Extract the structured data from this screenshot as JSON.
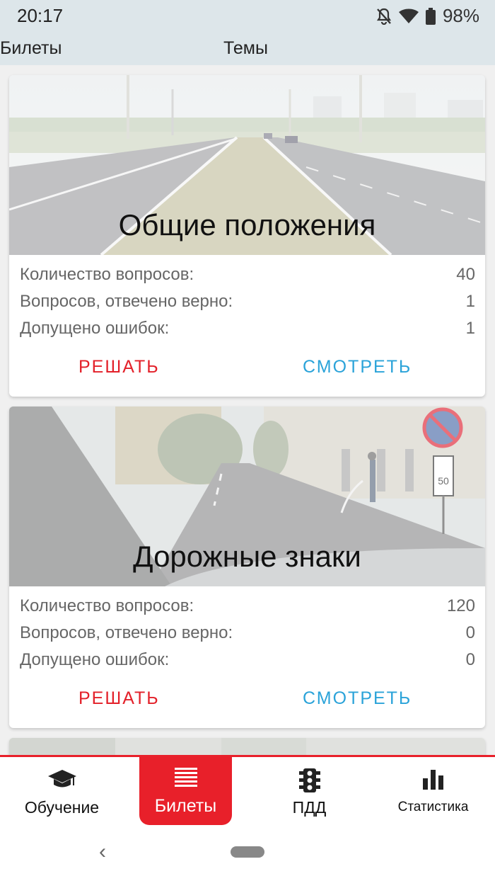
{
  "status": {
    "time": "20:17",
    "battery": "98%"
  },
  "top_tabs": {
    "tickets": "Билеты",
    "topics": "Темы"
  },
  "topics": [
    {
      "title": "Общие положения",
      "stats": [
        {
          "label": "Количество вопросов:",
          "value": "40"
        },
        {
          "label": "Вопросов, отвечено верно:",
          "value": "1"
        },
        {
          "label": "Допущено ошибок:",
          "value": "1"
        }
      ],
      "solve": "РЕШАТЬ",
      "view": "СМОТРЕТЬ"
    },
    {
      "title": "Дорожные знаки",
      "stats": [
        {
          "label": "Количество вопросов:",
          "value": "120"
        },
        {
          "label": "Вопросов, отвечено верно:",
          "value": "0"
        },
        {
          "label": "Допущено ошибок:",
          "value": "0"
        }
      ],
      "solve": "РЕШАТЬ",
      "view": "СМОТРЕТЬ",
      "sign_text": "50"
    }
  ],
  "bottom_nav": {
    "learning": "Обучение",
    "tickets": "Билеты",
    "pdd": "ПДД",
    "statistics": "Статистика"
  },
  "icons": {
    "learning": "graduation-cap-icon",
    "tickets": "list-lines-icon",
    "pdd": "traffic-light-icon",
    "statistics": "bar-chart-icon"
  },
  "colors": {
    "accent": "#e8202a",
    "solve": "#e3212a",
    "view": "#2ba3d9",
    "bar": "#dde6ea"
  }
}
